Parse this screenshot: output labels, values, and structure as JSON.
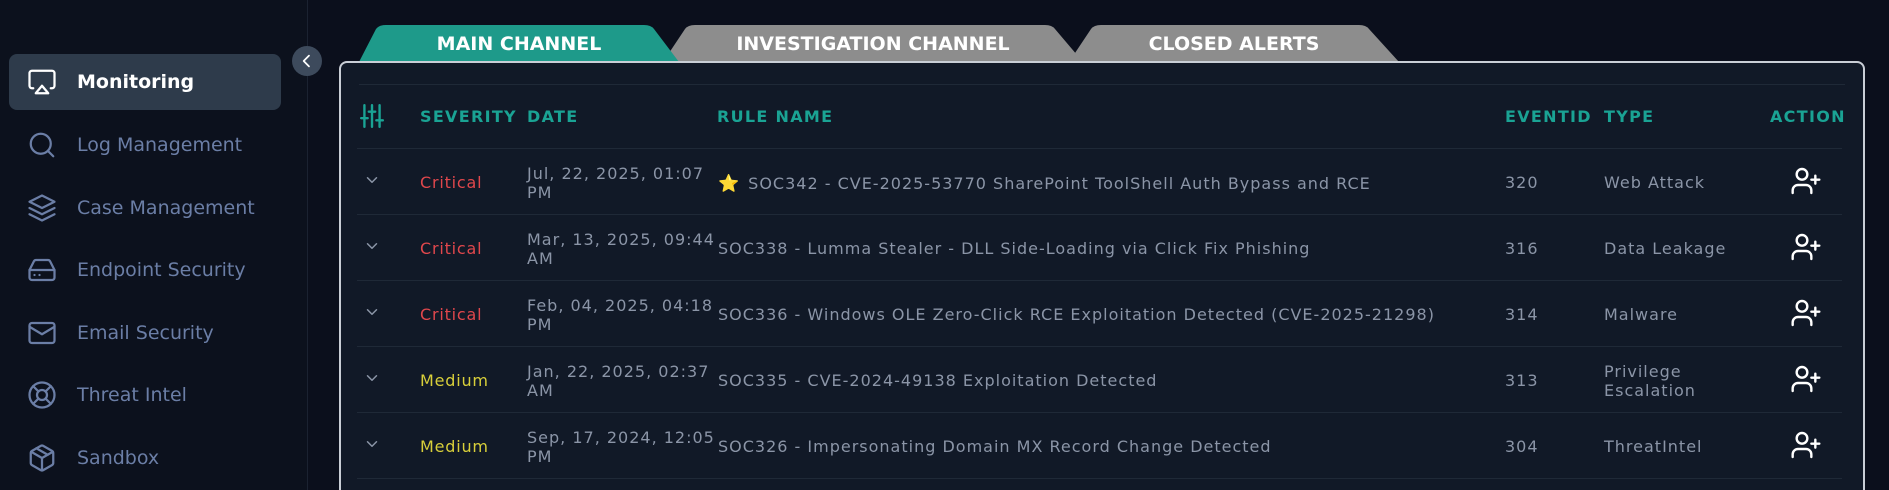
{
  "sidebar": {
    "items": [
      {
        "label": "Monitoring",
        "icon": "monitor-cast-icon",
        "active": true
      },
      {
        "label": "Log Management",
        "icon": "search-icon",
        "active": false
      },
      {
        "label": "Case Management",
        "icon": "layers-icon",
        "active": false
      },
      {
        "label": "Endpoint Security",
        "icon": "hard-drive-icon",
        "active": false
      },
      {
        "label": "Email Security",
        "icon": "mail-icon",
        "active": false
      },
      {
        "label": "Threat Intel",
        "icon": "lifebuoy-icon",
        "active": false
      },
      {
        "label": "Sandbox",
        "icon": "box-icon",
        "active": false
      }
    ]
  },
  "tabs": [
    {
      "label": "MAIN CHANNEL",
      "active": true
    },
    {
      "label": "INVESTIGATION CHANNEL",
      "active": false
    },
    {
      "label": "CLOSED ALERTS",
      "active": false
    }
  ],
  "table": {
    "headers": {
      "severity": "SEVERITY",
      "date": "DATE",
      "rule_name": "RULE NAME",
      "eventid": "EVENTID",
      "type": "TYPE",
      "action": "ACTION"
    },
    "rows": [
      {
        "severity": "Critical",
        "date_line1": "Jul, 22, 2025, 01:07",
        "date_line2": "PM",
        "starred": true,
        "rule": "SOC342 - CVE-2025-53770 SharePoint ToolShell Auth Bypass and RCE",
        "eventid": "320",
        "type_line1": "Web Attack",
        "type_line2": ""
      },
      {
        "severity": "Critical",
        "date_line1": "Mar, 13, 2025, 09:44",
        "date_line2": "AM",
        "starred": false,
        "rule": "SOC338 - Lumma Stealer - DLL Side-Loading via Click Fix Phishing",
        "eventid": "316",
        "type_line1": "Data Leakage",
        "type_line2": ""
      },
      {
        "severity": "Critical",
        "date_line1": "Feb, 04, 2025, 04:18",
        "date_line2": "PM",
        "starred": false,
        "rule": "SOC336 - Windows OLE Zero-Click RCE Exploitation Detected (CVE-2025-21298)",
        "eventid": "314",
        "type_line1": "Malware",
        "type_line2": ""
      },
      {
        "severity": "Medium",
        "date_line1": "Jan, 22, 2025, 02:37",
        "date_line2": "AM",
        "starred": false,
        "rule": "SOC335 - CVE-2024-49138 Exploitation Detected",
        "eventid": "313",
        "type_line1": "Privilege",
        "type_line2": "Escalation"
      },
      {
        "severity": "Medium",
        "date_line1": "Sep, 17, 2024, 12:05",
        "date_line2": "PM",
        "starred": false,
        "rule": "SOC326 - Impersonating Domain MX Record Change Detected",
        "eventid": "304",
        "type_line1": "ThreatIntel",
        "type_line2": ""
      }
    ]
  },
  "colors": {
    "accent": "#1aa394",
    "critical": "#e0474c",
    "medium": "#d8cf3a",
    "active_tab": "#1e9a8a",
    "inactive_tab": "#8d8d8d"
  }
}
